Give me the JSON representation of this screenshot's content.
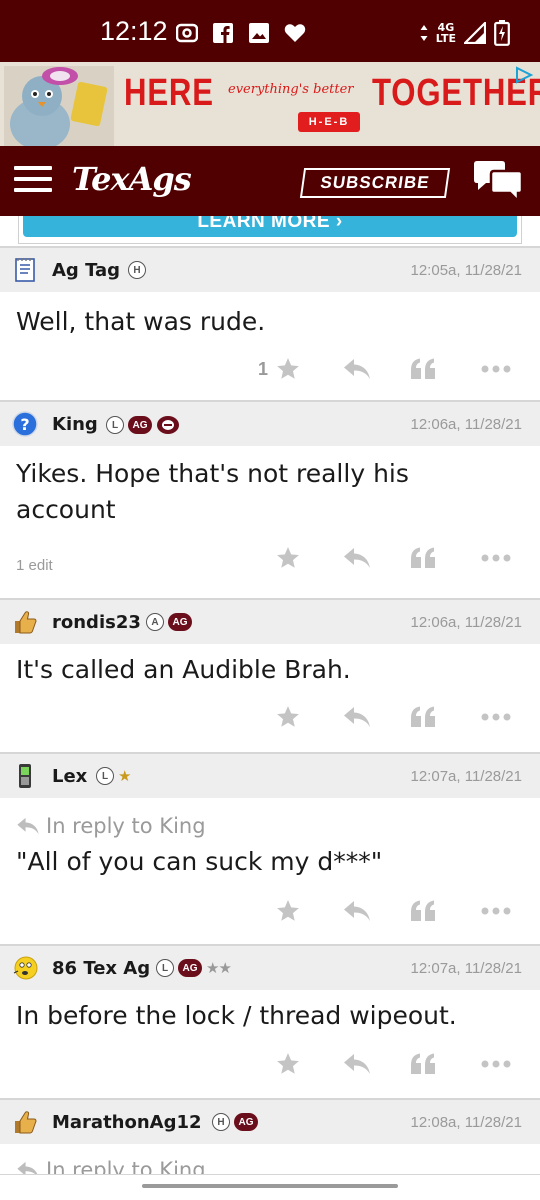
{
  "status_bar": {
    "time": "12:12",
    "network": "4G",
    "network_sub": "LTE",
    "bg_color": "#500000",
    "left_icons": [
      "screen-record-icon",
      "facebook-icon",
      "gallery-icon",
      "heart-icon"
    ],
    "right_icons": [
      "data-arrows-icon",
      "signal-icon",
      "battery-icon"
    ]
  },
  "ad": {
    "word_here": "HERE",
    "word_everything": "everything's better",
    "word_together": "TOGETHER",
    "brand": "H-E-B"
  },
  "topnav": {
    "logo": "TexAgs",
    "subscribe_label": "SUBSCRIBE",
    "bg_color": "#500000"
  },
  "learn_more": {
    "label": "LEARN MORE ›"
  },
  "posts": [
    {
      "username": "Ag Tag",
      "badges": [
        "H"
      ],
      "timestamp": "12:05a, 11/28/21",
      "reply_to": "",
      "body": "Well, that was rude.",
      "like_count": "1",
      "edits": ""
    },
    {
      "username": "King",
      "badges": [
        "L",
        "AG"
      ],
      "timestamp": "12:06a, 11/28/21",
      "reply_to": "",
      "body": "Yikes. Hope that's not really his account",
      "like_count": "",
      "edits": "1 edit"
    },
    {
      "username": "rondis23",
      "badges": [
        "A",
        "AG"
      ],
      "timestamp": "12:06a, 11/28/21",
      "reply_to": "",
      "body": "It's called an Audible Brah.",
      "like_count": "",
      "edits": ""
    },
    {
      "username": "Lex",
      "badges": [
        "L",
        "★"
      ],
      "timestamp": "12:07a, 11/28/21",
      "reply_to": "In reply to King",
      "body": "\"All of you can suck my d***\"",
      "like_count": "",
      "edits": ""
    },
    {
      "username": "86 Tex Ag",
      "badges": [
        "L",
        "AG",
        "★★"
      ],
      "timestamp": "12:07a, 11/28/21",
      "reply_to": "",
      "body": "In before the lock / thread wipeout.",
      "like_count": "",
      "edits": ""
    },
    {
      "username": "MarathonAg12",
      "badges": [
        "H",
        "AG"
      ],
      "timestamp": "12:08a, 11/28/21",
      "reply_to": "In reply to King",
      "body": "",
      "like_count": "",
      "edits": ""
    }
  ]
}
